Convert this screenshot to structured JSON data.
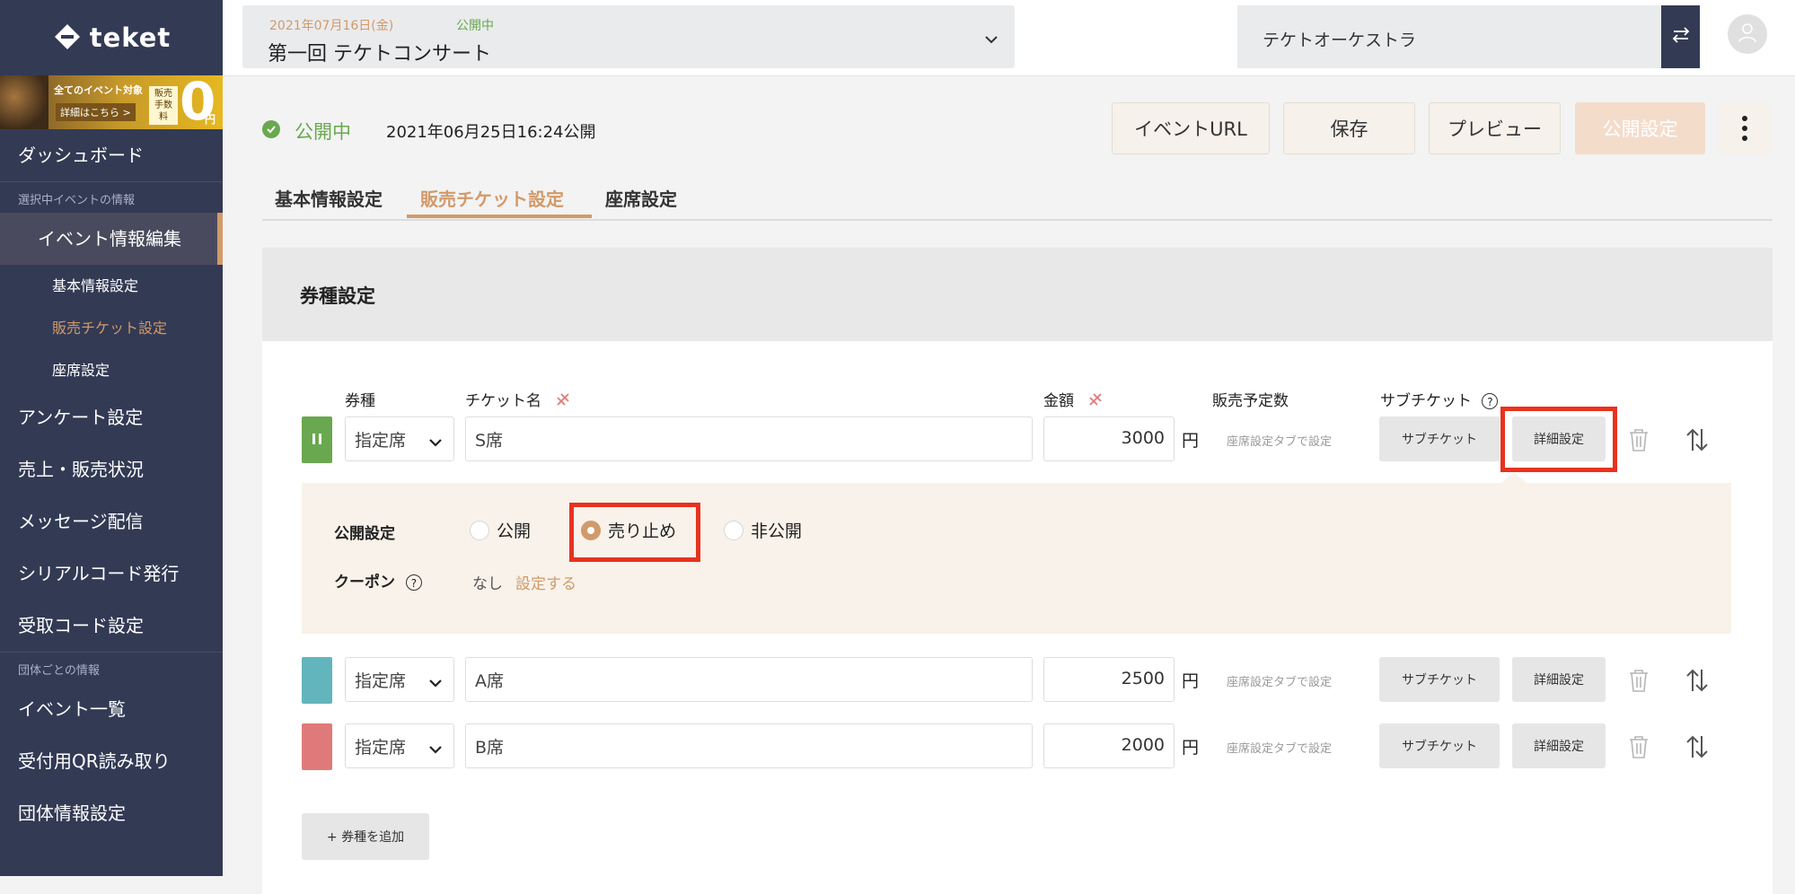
{
  "app": {
    "logo_text": "teket"
  },
  "banner": {
    "line1": "全てのイベント対象",
    "line2": "詳細はこちら >",
    "fee_label": "販売 手数料",
    "fee_value": "0",
    "fee_unit": "円"
  },
  "sidebar": {
    "dashboard": "ダッシュボード",
    "section_event": "選択中イベントの情報",
    "active": "イベント情報編集",
    "subs": [
      "基本情報設定",
      "販売チケット設定",
      "座席設定"
    ],
    "items_event": [
      "アンケート設定",
      "売上・販売状況",
      "メッセージ配信",
      "シリアルコード発行",
      "受取コード設定"
    ],
    "section_org": "団体ごとの情報",
    "items_org": [
      "イベント一覧",
      "受付用QR読み取り",
      "団体情報設定"
    ]
  },
  "topbar": {
    "event_date": "2021年07月16日(金)",
    "event_status": "公開中",
    "event_title": "第一回 テケトコンサート",
    "org_name": "テケトオーケストラ"
  },
  "status": {
    "label": "公開中",
    "published_at": "2021年06月25日16:24公開"
  },
  "actions": {
    "event_url": "イベントURL",
    "save": "保存",
    "preview": "プレビュー",
    "publish": "公開設定"
  },
  "tabs": [
    "基本情報設定",
    "販売チケット設定",
    "座席設定"
  ],
  "panel": {
    "title": "券種設定",
    "columns": {
      "type": "券種",
      "name": "チケット名",
      "price": "金額",
      "stock": "販売予定数",
      "sub": "サブチケット",
      "help": "?"
    },
    "tickets": [
      {
        "type": "指定席",
        "name": "S席",
        "price": "3000",
        "yen": "円",
        "stock": "座席設定タブで設定",
        "sub_btn": "サブチケット",
        "detail_btn": "詳細設定",
        "color": "#6aa84f"
      },
      {
        "type": "指定席",
        "name": "A席",
        "price": "2500",
        "yen": "円",
        "stock": "座席設定タブで設定",
        "sub_btn": "サブチケット",
        "detail_btn": "詳細設定",
        "color": "#62b5bd"
      },
      {
        "type": "指定席",
        "name": "B席",
        "price": "2000",
        "yen": "円",
        "stock": "座席設定タブで設定",
        "sub_btn": "サブチケット",
        "detail_btn": "詳細設定",
        "color": "#e07a7a"
      }
    ],
    "detail": {
      "publish_label": "公開設定",
      "options": [
        "公開",
        "売り止め",
        "非公開"
      ],
      "selected": "売り止め",
      "coupon_label": "クーポン",
      "coupon_help": "?",
      "coupon_value": "なし",
      "coupon_link": "設定する"
    },
    "add_button": "+ 券種を追加"
  }
}
